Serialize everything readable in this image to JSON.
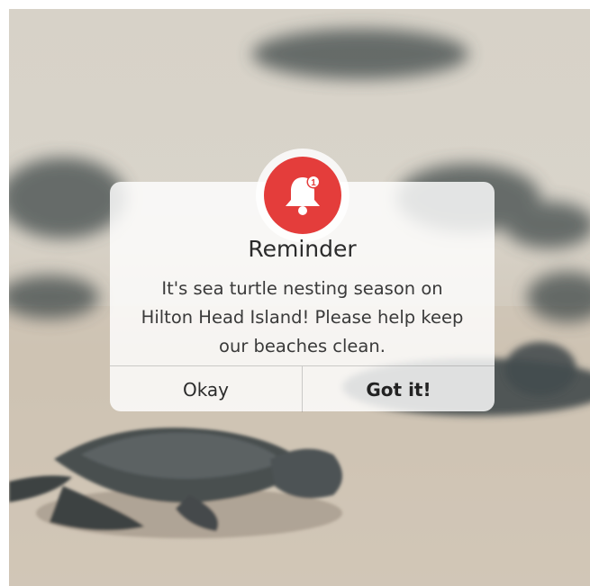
{
  "dialog": {
    "title": "Reminder",
    "message": "It's sea turtle nesting season on Hilton Head Island! Please help keep our beaches clean.",
    "buttons": {
      "okay": "Okay",
      "got_it": "Got it!"
    },
    "badge_count": "1"
  },
  "icons": {
    "bell": "bell-icon",
    "badge": "notification-badge"
  },
  "colors": {
    "accent": "#e43d3b",
    "dialog_bg": "#ffffff",
    "text": "#2b2b2b"
  },
  "background": {
    "description_icon": "sea-turtle-hatchlings-photo"
  }
}
